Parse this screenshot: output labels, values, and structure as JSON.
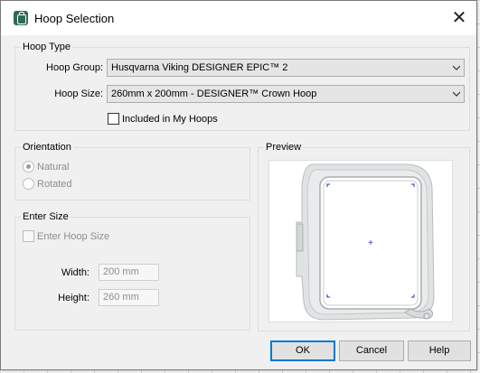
{
  "window": {
    "title": "Hoop Selection",
    "close_glyph": "✕",
    "icon": "hoop-app-icon"
  },
  "hoop_type": {
    "group_label": "Hoop Type",
    "group_label_field": "Hoop Group:",
    "group_value": "Husqvarna Viking DESIGNER EPIC™ 2",
    "size_label_field": "Hoop Size:",
    "size_value": "260mm x 200mm - DESIGNER™ Crown Hoop",
    "included_label": "Included in My Hoops",
    "included_checked": false
  },
  "orientation": {
    "group_label": "Orientation",
    "natural_label": "Natural",
    "rotated_label": "Rotated",
    "selected": "Natural"
  },
  "enter_size": {
    "group_label": "Enter Size",
    "enter_hoop_size_label": "Enter Hoop Size",
    "enter_hoop_size_checked": false,
    "width_label": "Width:",
    "width_value": "200 mm",
    "height_label": "Height:",
    "height_value": "260 mm"
  },
  "preview": {
    "group_label": "Preview",
    "center_mark": "+"
  },
  "buttons": {
    "ok": "OK",
    "cancel": "Cancel",
    "help": "Help"
  },
  "colors": {
    "dialog_bg": "#f0f0f0",
    "accent_border": "#0078d7",
    "hoop_frame": "#d8dcdc",
    "hoop_marks": "#2a2ad0"
  }
}
